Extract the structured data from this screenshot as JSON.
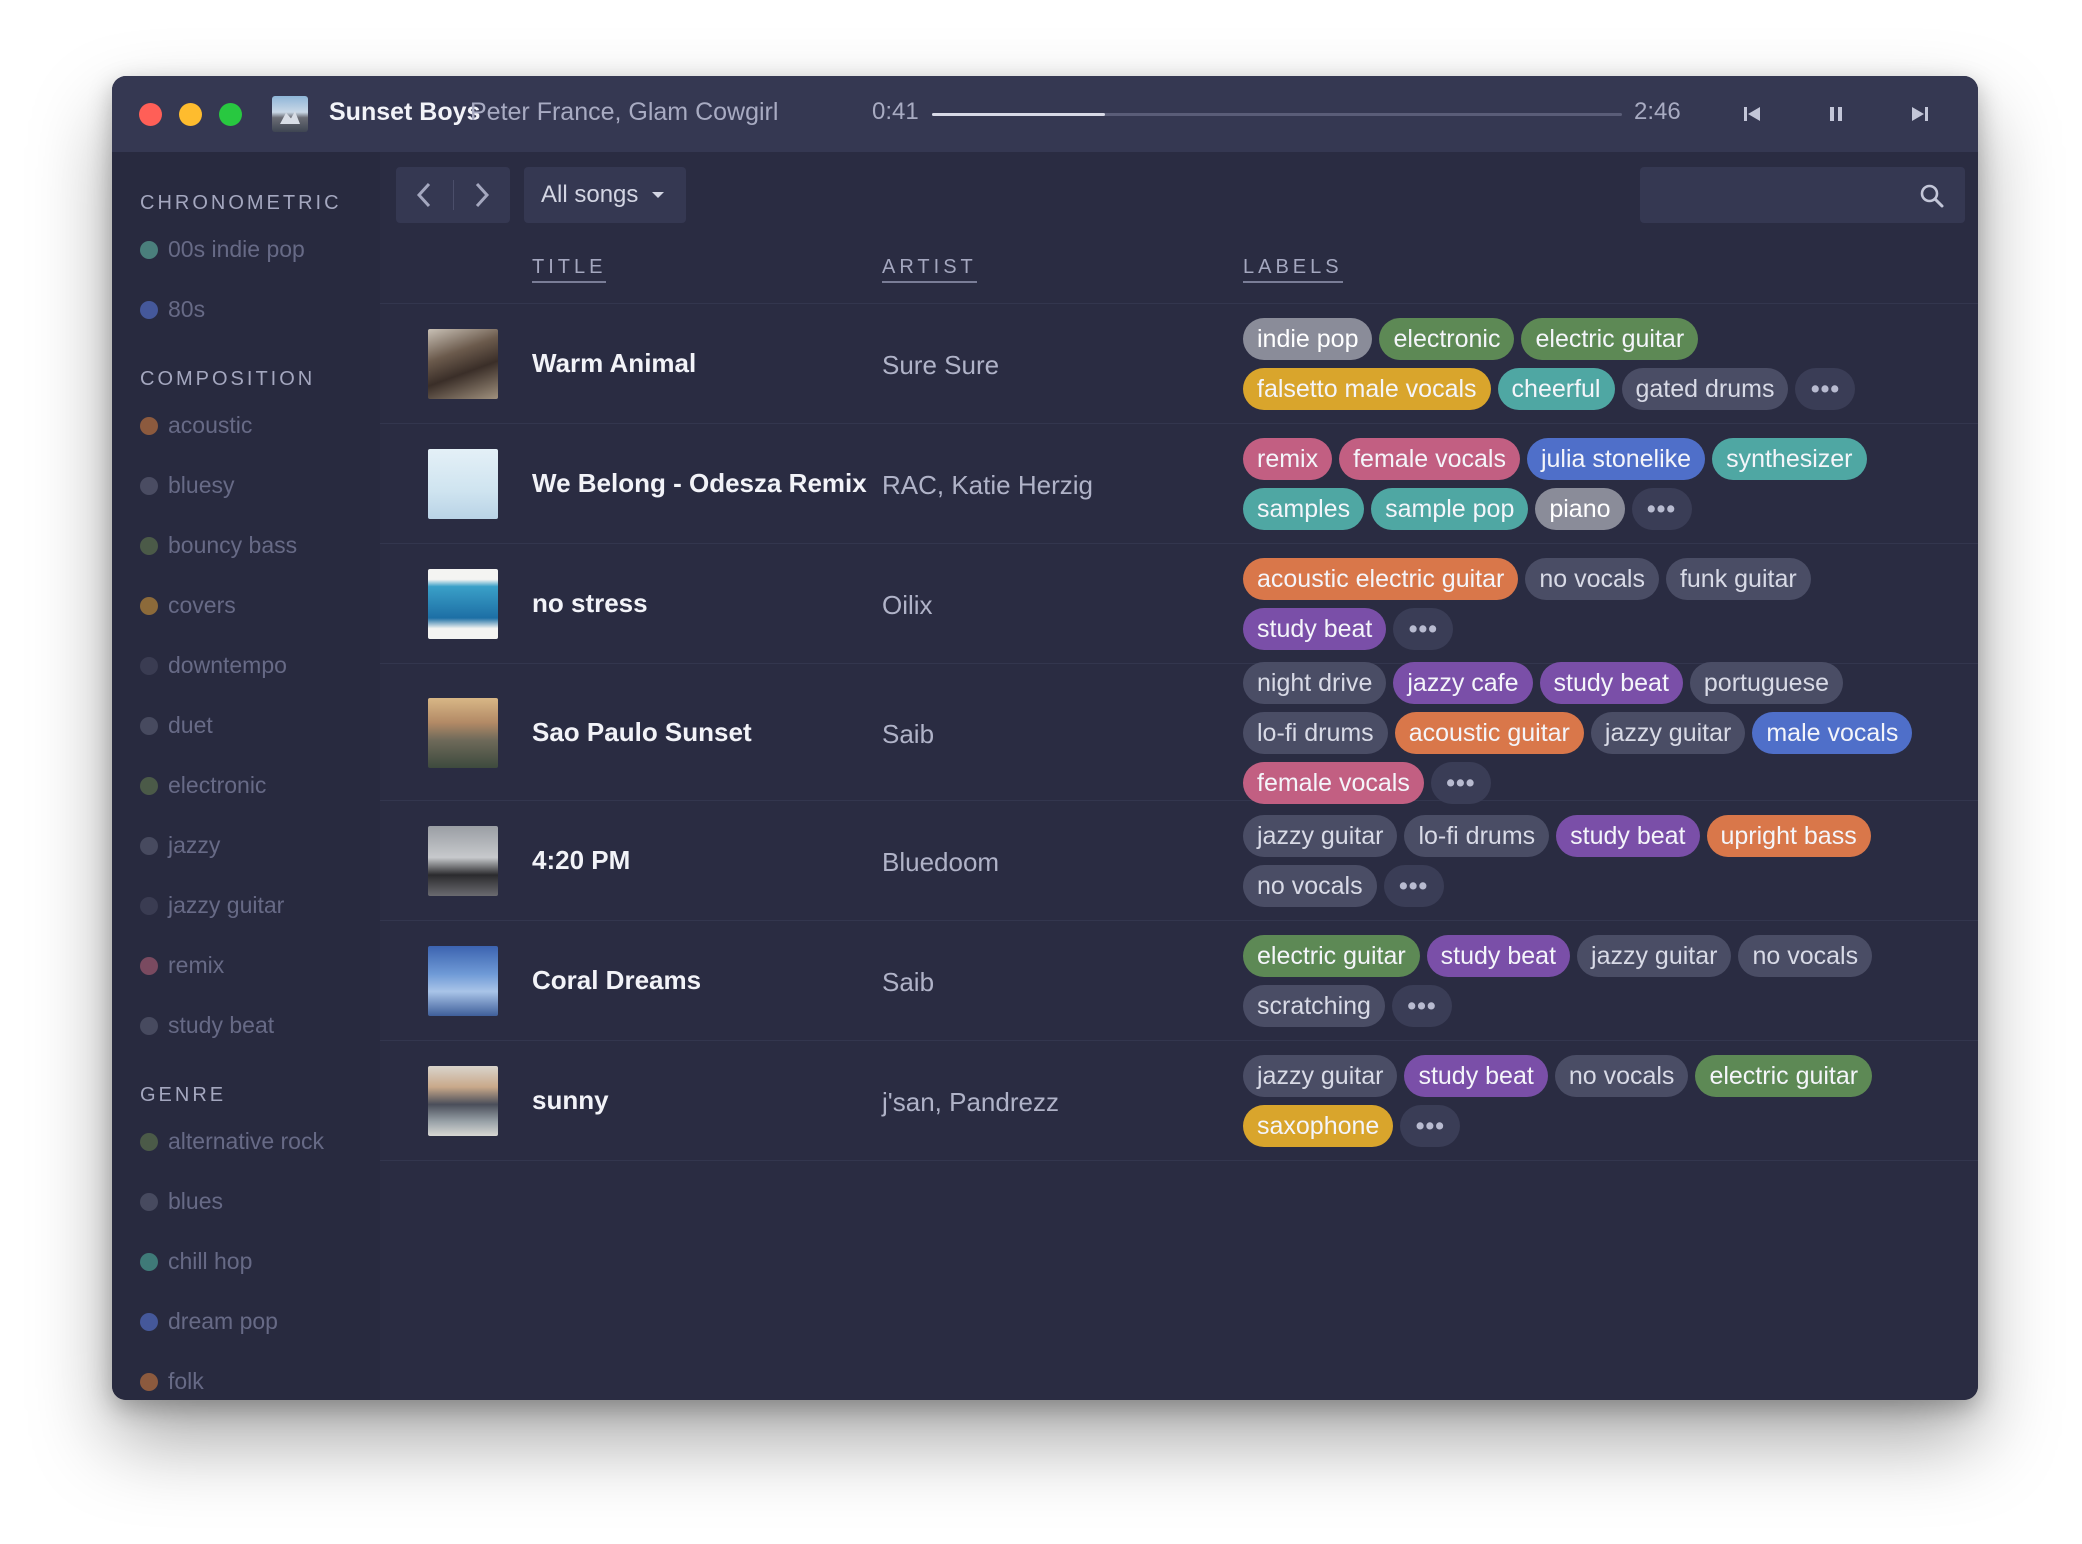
{
  "window": {
    "now_playing": {
      "title": "Sunset Boys",
      "artist": "Peter France, Glam Cowgirl",
      "current_time": "0:41",
      "total_time": "2:46",
      "progress": 0.25
    }
  },
  "colors": {
    "grey": "#4a4d65",
    "lightgrey": "#8a8c99",
    "green": "#5d8955",
    "yellow": "#d9a52c",
    "teal": "#4fa7a3",
    "pink": "#c25f82",
    "blue": "#4f6fc9",
    "purple": "#7a4fa8",
    "orange": "#d9774a"
  },
  "sidebar": {
    "sections": [
      {
        "heading": "CHRONOMETRIC",
        "items": [
          {
            "label": "00s indie pop",
            "dot": "#4a7f7c"
          },
          {
            "label": "80s",
            "dot": "#45589a"
          }
        ]
      },
      {
        "heading": "COMPOSITION",
        "items": [
          {
            "label": "acoustic",
            "dot": "#8c5a3e"
          },
          {
            "label": "bluesy",
            "dot": "#4a4c62"
          },
          {
            "label": "bouncy bass",
            "dot": "#4b5a48"
          },
          {
            "label": "covers",
            "dot": "#8c6a3a"
          },
          {
            "label": "downtempo",
            "dot": "#3a3c52"
          },
          {
            "label": "duet",
            "dot": "#474a5f"
          },
          {
            "label": "electronic",
            "dot": "#4b5a48"
          },
          {
            "label": "jazzy",
            "dot": "#474a5f"
          },
          {
            "label": "jazzy guitar",
            "dot": "#3a3c52"
          },
          {
            "label": "remix",
            "dot": "#7a4a60"
          },
          {
            "label": "study beat",
            "dot": "#474a5f"
          }
        ]
      },
      {
        "heading": "GENRE",
        "items": [
          {
            "label": "alternative rock",
            "dot": "#4b5a48"
          },
          {
            "label": "blues",
            "dot": "#474a5f"
          },
          {
            "label": "chill hop",
            "dot": "#3f7a78"
          },
          {
            "label": "dream pop",
            "dot": "#45589a"
          },
          {
            "label": "folk",
            "dot": "#8c5a3e"
          }
        ]
      }
    ]
  },
  "toolbar": {
    "filter_label": "All songs",
    "search_placeholder": ""
  },
  "table": {
    "columns": {
      "title": "TITLE",
      "artist": "ARTIST",
      "labels": "LABELS"
    },
    "more_label": "•••",
    "rows": [
      {
        "title": "Warm Animal",
        "artist": "Sure Sure",
        "art": "band",
        "labels": [
          {
            "text": "indie pop",
            "color": "lightgrey"
          },
          {
            "text": "electronic",
            "color": "green"
          },
          {
            "text": "electric guitar",
            "color": "green"
          },
          {
            "text": "falsetto male vocals",
            "color": "yellow"
          },
          {
            "text": "cheerful",
            "color": "teal"
          },
          {
            "text": "gated drums",
            "color": "grey"
          }
        ]
      },
      {
        "title": "We Belong - Odesza Remix",
        "artist": "RAC, Katie Herzig",
        "art": "light",
        "labels": [
          {
            "text": "remix",
            "color": "pink"
          },
          {
            "text": "female vocals",
            "color": "pink"
          },
          {
            "text": "julia stonelike",
            "color": "blue"
          },
          {
            "text": "synthesizer",
            "color": "teal"
          },
          {
            "text": "samples",
            "color": "teal"
          },
          {
            "text": "sample pop",
            "color": "teal"
          },
          {
            "text": "piano",
            "color": "lightgrey"
          }
        ]
      },
      {
        "title": "no stress",
        "artist": "Oilix",
        "art": "sea",
        "labels": [
          {
            "text": "acoustic electric guitar",
            "color": "orange"
          },
          {
            "text": "no vocals",
            "color": "grey"
          },
          {
            "text": "funk guitar",
            "color": "grey"
          },
          {
            "text": "study beat",
            "color": "purple"
          }
        ]
      },
      {
        "title": "Sao Paulo Sunset",
        "artist": "Saib",
        "art": "city",
        "labels": [
          {
            "text": "night drive",
            "color": "grey"
          },
          {
            "text": "jazzy cafe",
            "color": "purple"
          },
          {
            "text": "study beat",
            "color": "purple"
          },
          {
            "text": "portuguese",
            "color": "grey"
          },
          {
            "text": "lo-fi drums",
            "color": "grey"
          },
          {
            "text": "acoustic guitar",
            "color": "orange"
          },
          {
            "text": "jazzy guitar",
            "color": "grey"
          },
          {
            "text": "male vocals",
            "color": "blue"
          },
          {
            "text": "female vocals",
            "color": "pink"
          }
        ]
      },
      {
        "title": "4:20 PM",
        "artist": "Bluedoom",
        "art": "desk",
        "labels": [
          {
            "text": "jazzy guitar",
            "color": "grey"
          },
          {
            "text": "lo-fi drums",
            "color": "grey"
          },
          {
            "text": "study beat",
            "color": "purple"
          },
          {
            "text": "upright bass",
            "color": "orange"
          },
          {
            "text": "no vocals",
            "color": "grey"
          }
        ]
      },
      {
        "title": "Coral Dreams",
        "artist": "Saib",
        "art": "coral",
        "labels": [
          {
            "text": "electric guitar",
            "color": "green"
          },
          {
            "text": "study beat",
            "color": "purple"
          },
          {
            "text": "jazzy guitar",
            "color": "grey"
          },
          {
            "text": "no vocals",
            "color": "grey"
          },
          {
            "text": "scratching",
            "color": "grey"
          }
        ]
      },
      {
        "title": "sunny",
        "artist": "j'san, Pandrezz",
        "art": "sunset",
        "labels": [
          {
            "text": "jazzy guitar",
            "color": "grey"
          },
          {
            "text": "study beat",
            "color": "purple"
          },
          {
            "text": "no vocals",
            "color": "grey"
          },
          {
            "text": "electric guitar",
            "color": "green"
          },
          {
            "text": "saxophone",
            "color": "yellow"
          }
        ]
      }
    ]
  }
}
